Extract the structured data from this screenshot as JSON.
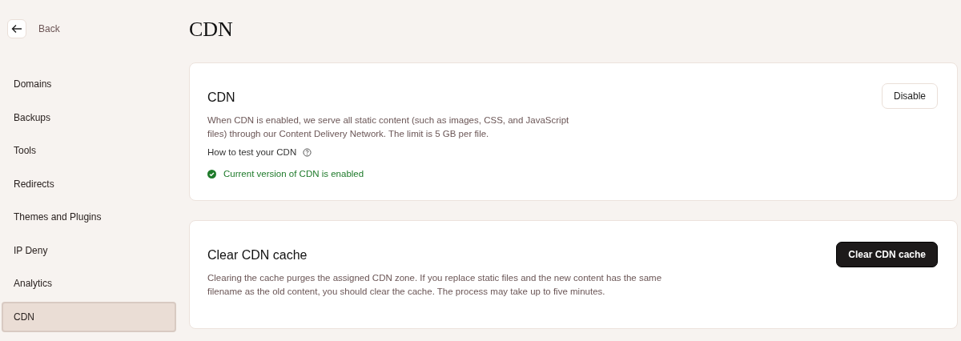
{
  "back": {
    "label": "Back"
  },
  "sidebar": {
    "items": [
      {
        "label": "Domains",
        "selected": false
      },
      {
        "label": "Backups",
        "selected": false
      },
      {
        "label": "Tools",
        "selected": false
      },
      {
        "label": "Redirects",
        "selected": false
      },
      {
        "label": "Themes and Plugins",
        "selected": false
      },
      {
        "label": "IP Deny",
        "selected": false
      },
      {
        "label": "Analytics",
        "selected": false
      },
      {
        "label": "CDN",
        "selected": true
      }
    ]
  },
  "page_title": "CDN",
  "cards": [
    {
      "title": "CDN",
      "description": "When CDN is enabled, we serve all static content (such as images, CSS, and JavaScript files) through our Content Delivery Network. The limit is 5 GB per file.",
      "help_link": "How to test your CDN",
      "status": {
        "kind": "success",
        "text": "Current version of CDN is enabled"
      },
      "button": {
        "label": "Disable",
        "kind": "secondary"
      }
    },
    {
      "title": "Clear CDN cache",
      "description": "Clearing the cache purges the assigned CDN zone. If you replace static files and the new content has the same filename as the old content, you should clear the cache. The process may take up to five minutes.",
      "button": {
        "label": "Clear CDN cache",
        "kind": "primary"
      }
    }
  ]
}
